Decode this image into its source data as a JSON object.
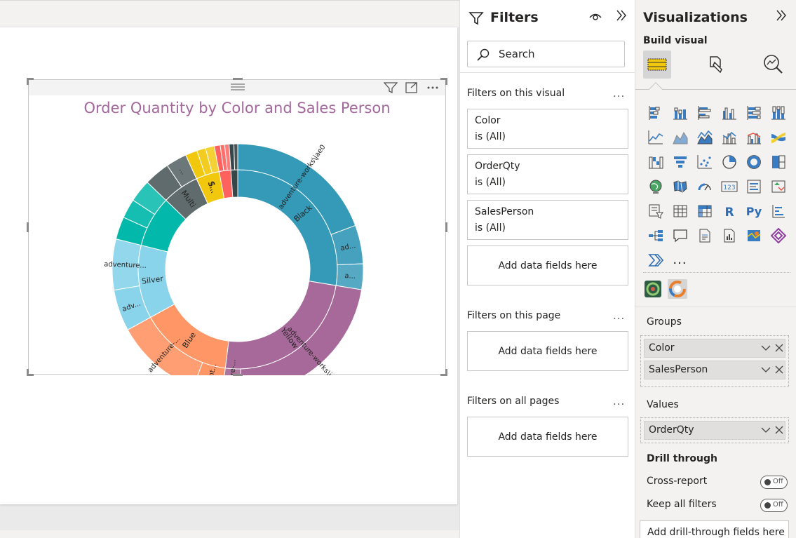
{
  "chart": {
    "title": "Order Quantity by Color and Sales Person"
  },
  "chart_data": {
    "type": "sunburst",
    "title": "Order Quantity by Color and Sales Person",
    "levels": [
      "Color",
      "SalesPerson"
    ],
    "value_field": "OrderQty",
    "inner_ring": [
      {
        "name": "Black",
        "value": 27.6,
        "color": "#3599b8",
        "label": "Black"
      },
      {
        "name": "Yellow",
        "value": 24.4,
        "color": "#a66999",
        "label": "Yellow"
      },
      {
        "name": "Blue",
        "value": 15.0,
        "color": "#fe9666",
        "label": "Blue"
      },
      {
        "name": "Silver",
        "value": 11.9,
        "color": "#8ad4eb",
        "label": "Silver"
      },
      {
        "name": "(unlabeled teal)",
        "value": 8.3,
        "color": "#01b8aa",
        "label": ""
      },
      {
        "name": "Multi",
        "value": 6.0,
        "color": "#5f6b6d",
        "label": "Multi"
      },
      {
        "name": "(unlabeled yellow)",
        "value": 3.8,
        "color": "#f2c80f",
        "label": "S..."
      },
      {
        "name": "(unlabeled red)",
        "value": 1.9,
        "color": "#fd625e",
        "label": ""
      },
      {
        "name": "(unlabeled dark)",
        "value": 1.1,
        "color": "#374649",
        "label": ""
      }
    ],
    "outer_ring_labels": [
      "adventure-works\\jae0",
      "ad...",
      "a...",
      "adventure-works\\j...",
      "adventure-...",
      "advent...",
      "adventure-...",
      "adv...",
      "adventure...",
      "...",
      "S..."
    ]
  },
  "filters": {
    "title": "Filters",
    "search_placeholder": "Search",
    "on_visual_heading": "Filters on this visual",
    "on_page_heading": "Filters on this page",
    "on_all_pages_heading": "Filters on all pages",
    "more": "...",
    "cards": [
      {
        "name": "Color",
        "state": "is (All)"
      },
      {
        "name": "OrderQty",
        "state": "is (All)"
      },
      {
        "name": "SalesPerson",
        "state": "is (All)"
      }
    ],
    "add_fields": "Add data fields here"
  },
  "visualizations": {
    "title": "Visualizations",
    "build_label": "Build visual",
    "more_visuals": "...",
    "groups_label": "Groups",
    "groups": [
      "Color",
      "SalesPerson"
    ],
    "values_label": "Values",
    "values": [
      "OrderQty"
    ],
    "drill_label": "Drill through",
    "cross_report": "Cross-report",
    "keep_filters": "Keep all filters",
    "toggle_off": "Off",
    "drill_drop": "Add drill-through fields here",
    "r_label": "R",
    "py_label": "Py",
    "num_label": "123"
  },
  "colors": {
    "accent_title": "#a4679c",
    "black_series": "#3599b8",
    "yellow_series": "#a66999",
    "blue_series": "#fe9666"
  }
}
